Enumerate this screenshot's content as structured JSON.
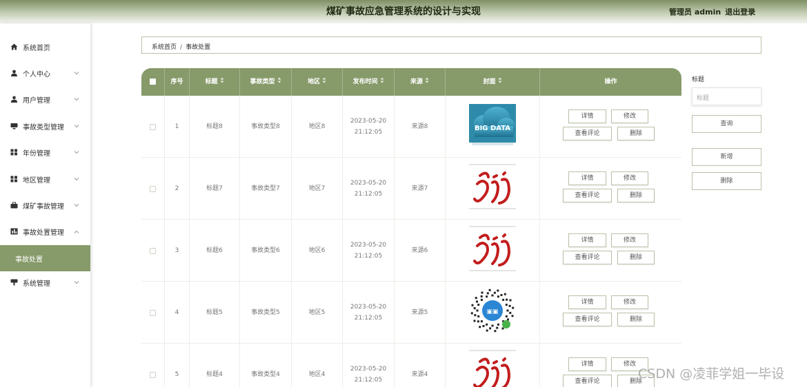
{
  "header": {
    "title": "煤矿事故应急管理系统的设计与实现",
    "user": "管理员 admin",
    "logout": "退出登录"
  },
  "sidebar": {
    "items": [
      {
        "label": "系统首页",
        "icon": "home-icon",
        "chevron": false
      },
      {
        "label": "个人中心",
        "icon": "user-icon",
        "chevron": true
      },
      {
        "label": "用户管理",
        "icon": "users-icon",
        "chevron": true
      },
      {
        "label": "事故类型管理",
        "icon": "monitor-icon",
        "chevron": true
      },
      {
        "label": "年份管理",
        "icon": "grid-icon",
        "chevron": true
      },
      {
        "label": "地区管理",
        "icon": "grid-icon",
        "chevron": true
      },
      {
        "label": "煤矿事故管理",
        "icon": "briefcase-icon",
        "chevron": true
      },
      {
        "label": "事故处置管理",
        "icon": "chart-icon",
        "chevron": true,
        "expanded": true
      },
      {
        "label": "事故处置",
        "icon": "",
        "chevron": false,
        "active": true,
        "sub": true
      },
      {
        "label": "系统管理",
        "icon": "system-icon",
        "chevron": true
      }
    ]
  },
  "breadcrumb": {
    "home": "系统首页",
    "sep": "/",
    "current": "事故处置"
  },
  "table": {
    "headers": [
      "",
      "序号",
      "标题",
      "事故类型",
      "地区",
      "发布时间",
      "来源",
      "封面",
      "操作"
    ],
    "rows": [
      {
        "idx": "1",
        "title": "标题8",
        "type": "事故类型8",
        "area": "地区8",
        "date": "2023-05-20",
        "time": "21:12:05",
        "source": "来源8",
        "cover": "bigdata"
      },
      {
        "idx": "2",
        "title": "标题7",
        "type": "事故类型7",
        "area": "地区7",
        "date": "2023-05-20",
        "time": "21:12:05",
        "source": "来源7",
        "cover": "logo"
      },
      {
        "idx": "3",
        "title": "标题6",
        "type": "事故类型6",
        "area": "地区6",
        "date": "2023-05-20",
        "time": "21:12:05",
        "source": "来源6",
        "cover": "logo"
      },
      {
        "idx": "4",
        "title": "标题5",
        "type": "事故类型5",
        "area": "地区5",
        "date": "2023-05-20",
        "time": "21:12:05",
        "source": "来源5",
        "cover": "qrcode"
      },
      {
        "idx": "5",
        "title": "标题4",
        "type": "事故类型4",
        "area": "地区4",
        "date": "2023-05-20",
        "time": "21:12:05",
        "source": "来源4",
        "cover": "logo"
      }
    ],
    "actions": {
      "detail": "详情",
      "edit": "修改",
      "comments": "查看评论",
      "delete": "删除"
    }
  },
  "search": {
    "label": "标题",
    "placeholder": "标题",
    "query_btn": "查询",
    "add_btn": "新增",
    "delete_btn": "删除"
  },
  "watermark": "CSDN @凌菲学姐一毕设",
  "colors": {
    "accent": "#879a6a",
    "border": "#b8c2a7"
  }
}
